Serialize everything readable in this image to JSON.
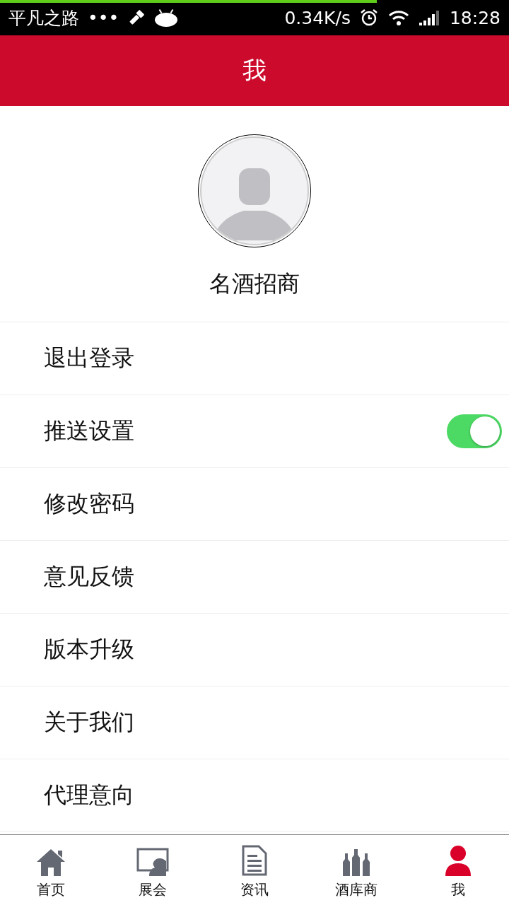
{
  "status_bar": {
    "loading_bar": {
      "level": 0.74
    },
    "carrier": "平凡之路",
    "dots": "•••",
    "speed": "0.34K/s",
    "time": "18:28"
  },
  "header": {
    "title": "我"
  },
  "profile": {
    "name": "名酒招商"
  },
  "menu": [
    {
      "kind": "link",
      "label": "退出登录"
    },
    {
      "kind": "switch",
      "label": "推送设置",
      "on": true
    },
    {
      "kind": "link",
      "label": "修改密码"
    },
    {
      "kind": "link",
      "label": "意见反馈"
    },
    {
      "kind": "link",
      "label": "版本升级"
    },
    {
      "kind": "link",
      "label": "关于我们"
    },
    {
      "kind": "link",
      "label": "代理意向"
    }
  ],
  "tabs": [
    {
      "label": "首页",
      "selected": false
    },
    {
      "label": "展会",
      "selected": false
    },
    {
      "label": "资讯",
      "selected": false
    },
    {
      "label": "酒库商",
      "selected": false
    },
    {
      "label": "我",
      "selected": true
    }
  ]
}
